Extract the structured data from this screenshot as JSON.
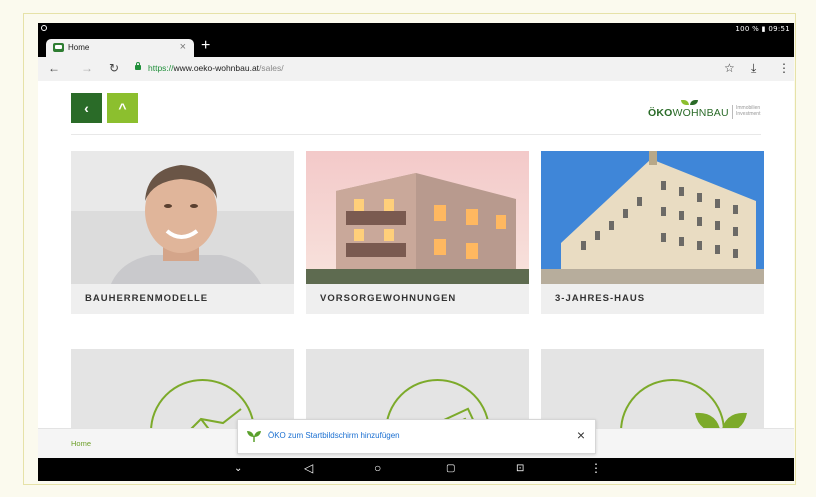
{
  "status_bar": {
    "right_text": "100 % ▮ 09:51"
  },
  "tab": {
    "title": "Home",
    "close_glyph": "×",
    "new_tab_glyph": "+"
  },
  "address_bar": {
    "url_secure": "https://",
    "url_host": "www.oeko-wohnbau.at",
    "url_path": "/sales/"
  },
  "header": {
    "logo": {
      "part1": "ÖKO",
      "part2": "WOHNBAU",
      "tagline": "Immobilien Investment"
    }
  },
  "cards": [
    {
      "label": "BAUHERRENMODELLE",
      "image": "portrait-photo"
    },
    {
      "label": "VORSORGEWOHNUNGEN",
      "image": "building-photo"
    },
    {
      "label": "3-JAHRES-HAUS",
      "image": "historic-building-photo"
    }
  ],
  "tiles": [
    {
      "icon": "handshake-icon"
    },
    {
      "icon": "newspaper-icon"
    },
    {
      "icon": "sprout-icon"
    }
  ],
  "footer": {
    "home_link": "Home"
  },
  "toast": {
    "text": "ÖKO zum Startbildschirm hinzufügen",
    "close_glyph": "×"
  },
  "colors": {
    "dark_green": "#2a6b28",
    "light_green": "#8cbf2e",
    "link_blue": "#1a6fd1"
  }
}
